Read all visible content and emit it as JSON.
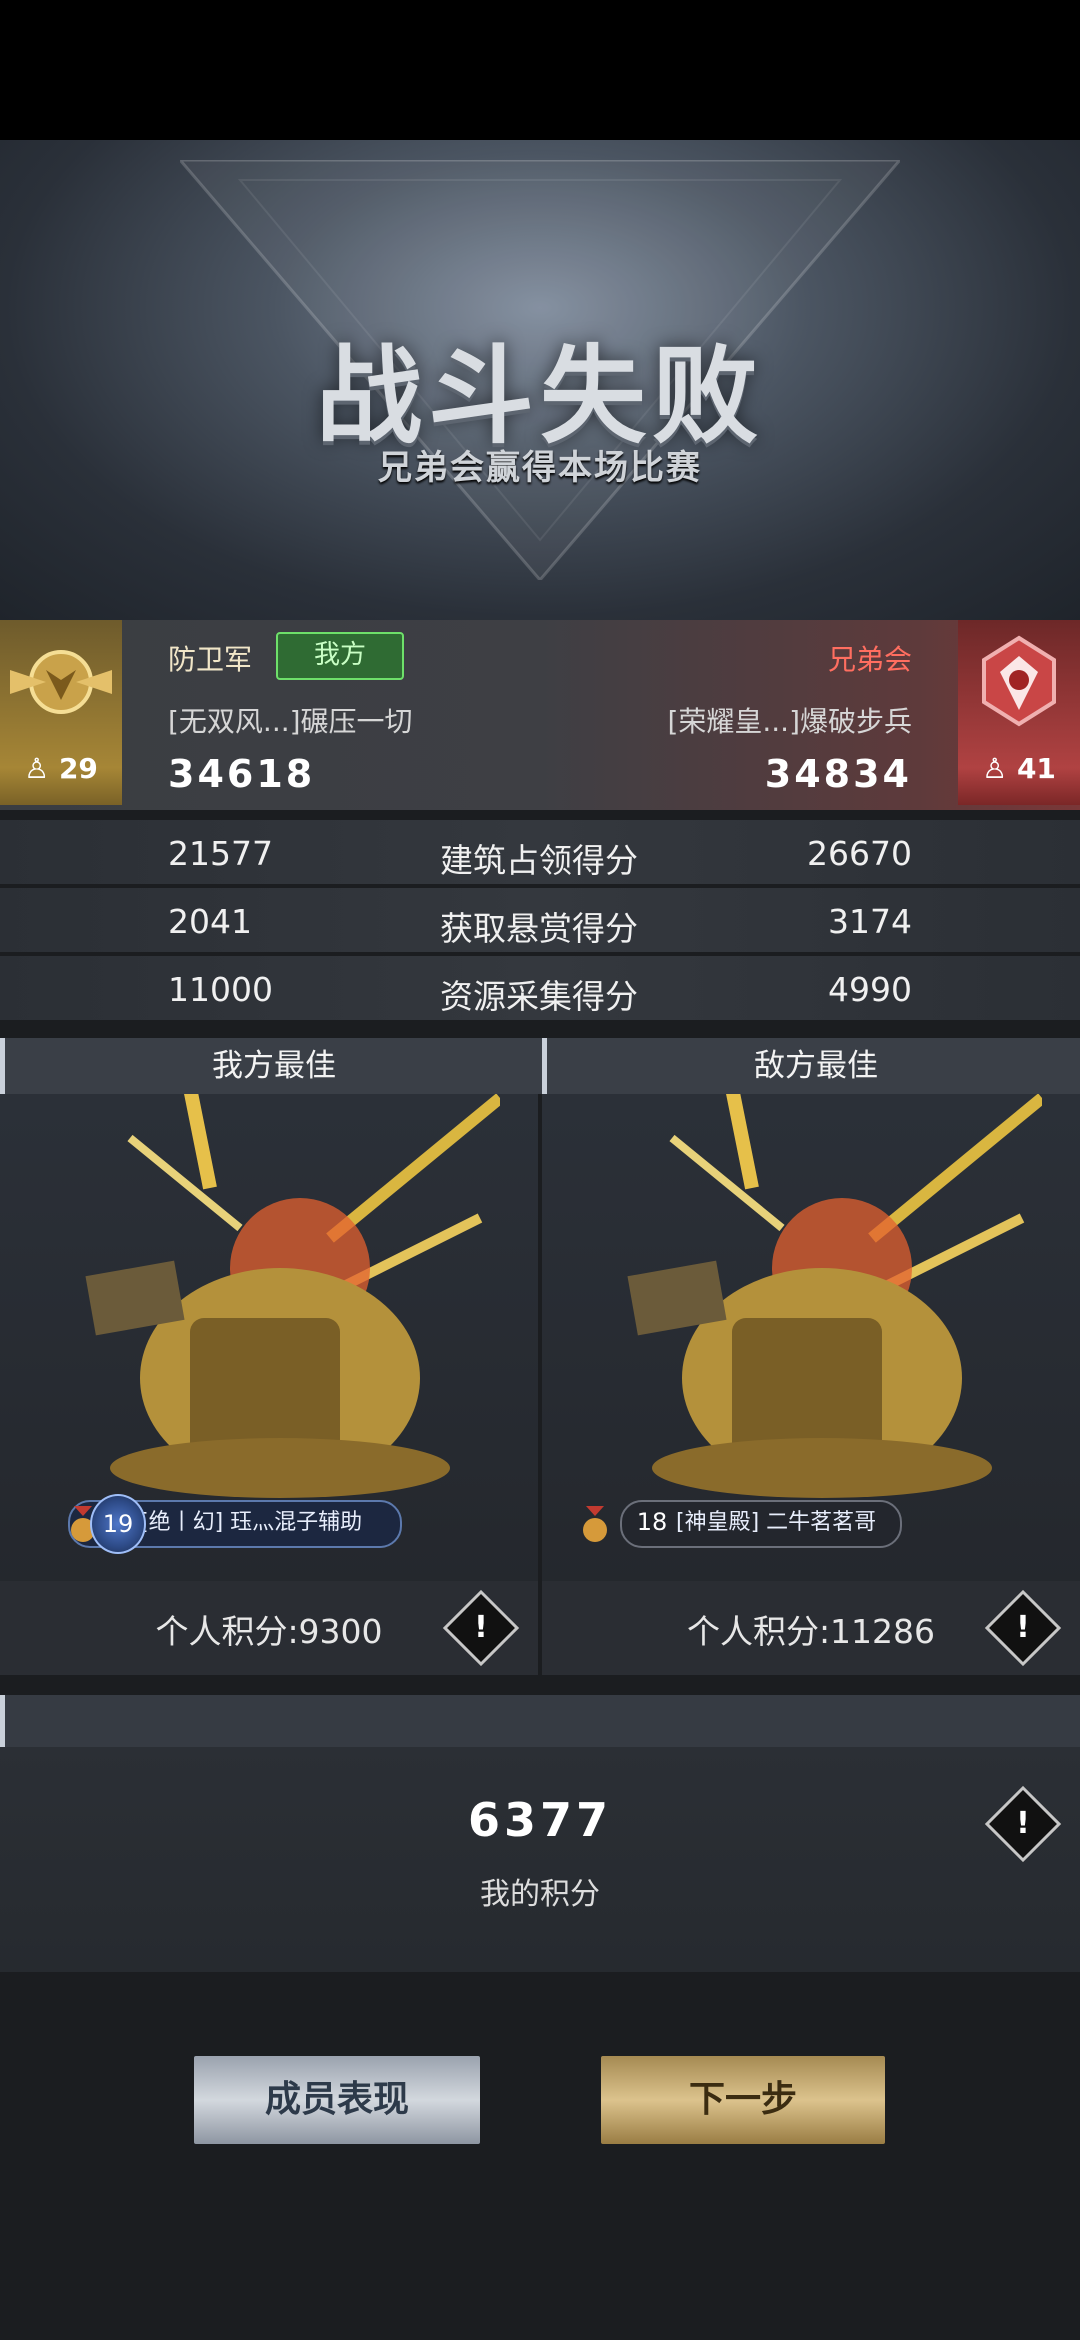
{
  "header": {
    "title": "战斗失败",
    "subtitle": "兄弟会赢得本场比赛"
  },
  "teams": {
    "ours": {
      "name": "防卫军",
      "tag": "我方",
      "commander": "[无双风...]碾压一切",
      "score": "34618",
      "members": "29"
    },
    "enemy": {
      "name": "兄弟会",
      "commander": "[荣耀皇...]爆破步兵",
      "score": "34834",
      "members": "41"
    }
  },
  "stats": [
    {
      "ours": "21577",
      "label": "建筑占领得分",
      "enemy": "26670"
    },
    {
      "ours": "2041",
      "label": "获取悬赏得分",
      "enemy": "3174"
    },
    {
      "ours": "11000",
      "label": "资源采集得分",
      "enemy": "4990"
    }
  ],
  "best": {
    "ours": {
      "title": "我方最佳",
      "level": "19",
      "player": "[绝丨幻] 珏灬混子辅助",
      "points": "个人积分:9300"
    },
    "enemy": {
      "title": "敌方最佳",
      "level": "18",
      "player": "[神皇殿] 二牛茗茗哥",
      "points": "个人积分:11286"
    }
  },
  "my": {
    "score": "6377",
    "label": "我的积分"
  },
  "buttons": {
    "members": "成员表现",
    "next": "下一步"
  },
  "colors": {
    "ally_accent": "#6ee06a",
    "enemy_accent": "#ff6e60",
    "gold": "#dcc38d"
  }
}
